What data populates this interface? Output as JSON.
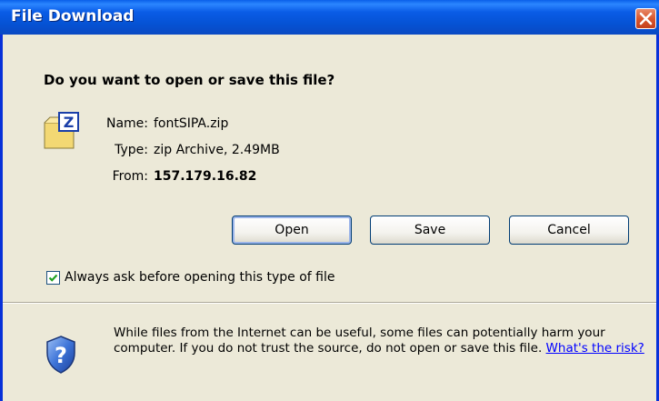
{
  "window": {
    "title": "File Download"
  },
  "dialog": {
    "question": "Do you want to open or save this file?",
    "file": {
      "icon": "zip-archive-icon",
      "name_label": "Name:",
      "name": "fontSIPA.zip",
      "type_label": "Type:",
      "type": "zip Archive, 2.49MB",
      "from_label": "From:",
      "from": "157.179.16.82"
    },
    "buttons": {
      "open": "Open",
      "save": "Save",
      "cancel": "Cancel"
    },
    "checkbox": {
      "label": "Always ask before opening this type of file",
      "checked": true
    },
    "warning": {
      "icon": "security-shield-icon",
      "text": "While files from the Internet can be useful, some files can potentially harm your computer. If you do not trust the source, do not open or save this file.",
      "link": "What's the risk?"
    }
  }
}
